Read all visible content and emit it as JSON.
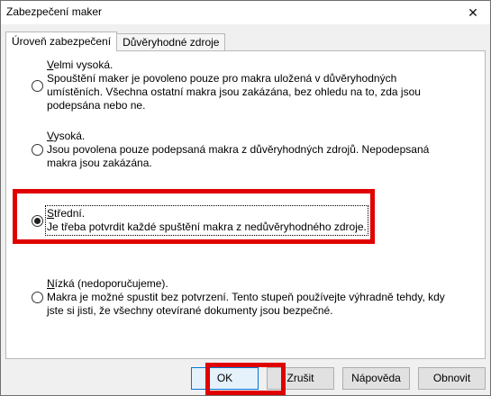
{
  "window": {
    "title": "Zabezpečení maker",
    "close_symbol": "✕"
  },
  "tabs": [
    {
      "label": "Úroveň zabezpečení",
      "active": true
    },
    {
      "label": "Důvěryhodné zdroje",
      "active": false
    }
  ],
  "security_options": [
    {
      "title": "Velmi vysoká.",
      "description": "Spouštění maker je povoleno pouze pro makra uložená v důvěryhodných umístěních. Všechna ostatní makra jsou zakázána, bez ohledu na to, zda jsou podepsána nebo ne.",
      "selected": false
    },
    {
      "title": "Vysoká.",
      "description": "Jsou povolena pouze podepsaná makra z důvěryhodných zdrojů. Nepodepsaná makra jsou zakázána.",
      "selected": false
    },
    {
      "title": "Střední.",
      "description": "Je třeba potvrdit každé spuštění makra z nedůvěryhodného zdroje.",
      "selected": true
    },
    {
      "title": "Nízká (nedoporučujeme).",
      "description": "Makra je možné spustit bez potvrzení. Tento stupeň používejte výhradně tehdy, kdy jste si jisti, že všechny otevírané dokumenty jsou bezpečné.",
      "selected": false
    }
  ],
  "buttons": {
    "ok": "OK",
    "cancel": "Zrušit",
    "help": "Nápověda",
    "reset": "Obnovit"
  },
  "highlight_color": "#e00000"
}
